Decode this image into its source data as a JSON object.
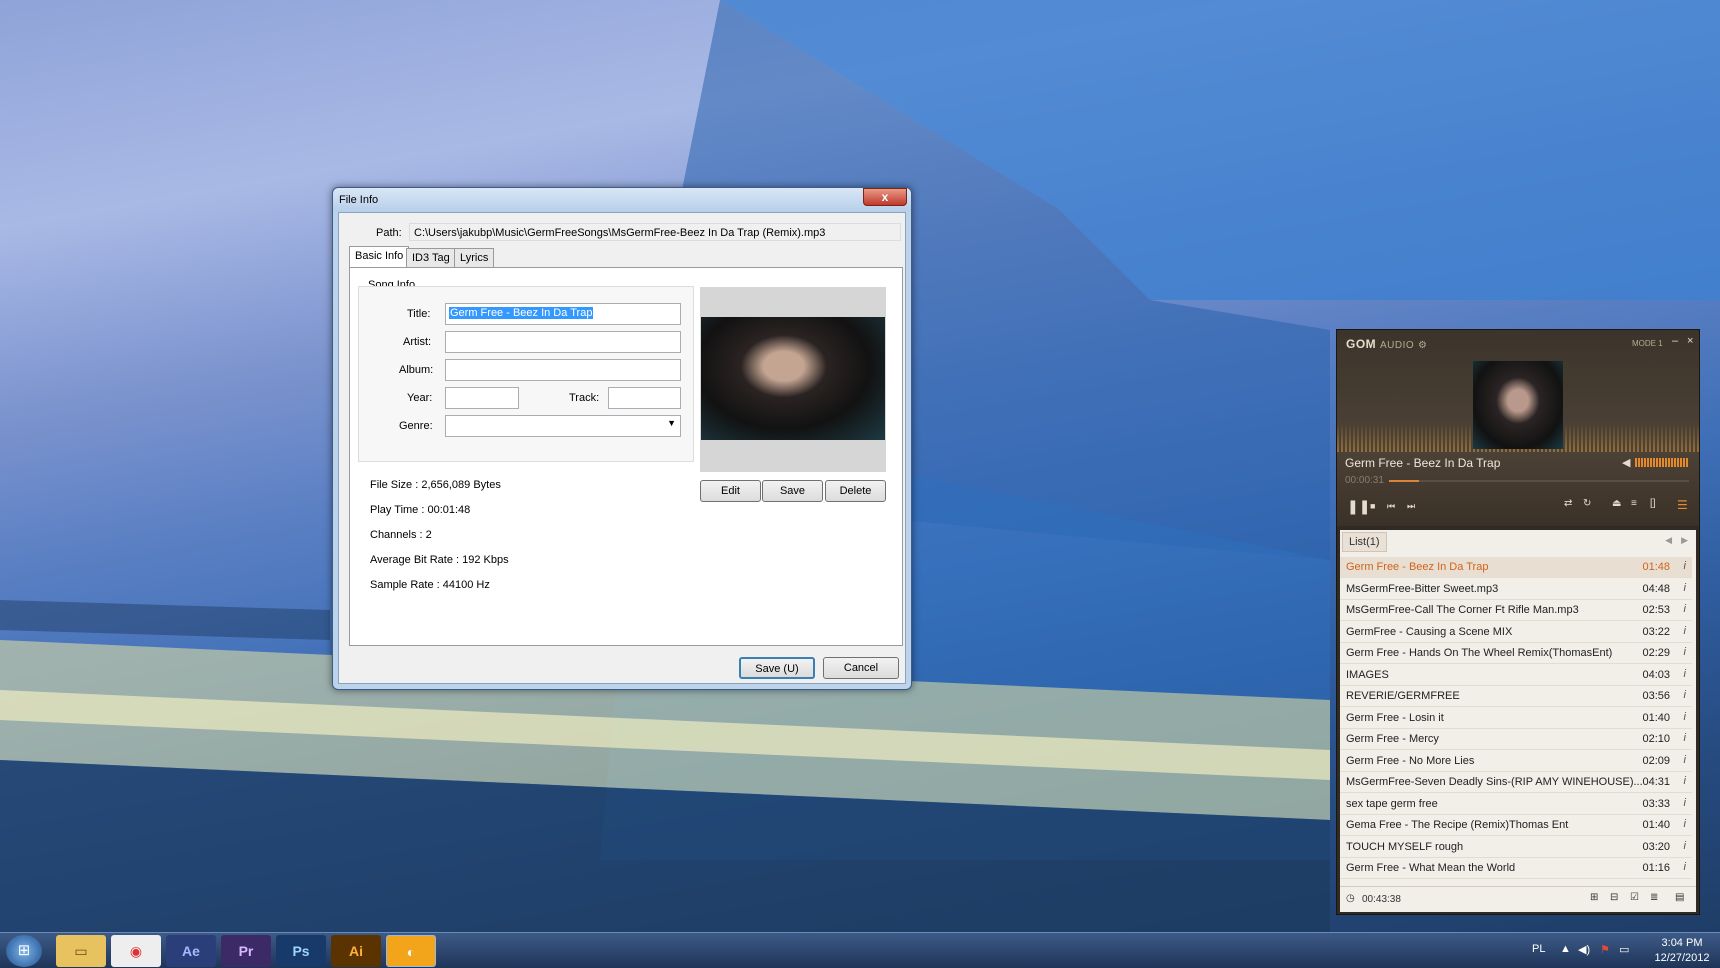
{
  "dialog": {
    "title": "File Info",
    "close": "x",
    "path_label": "Path:",
    "path_value": "C:\\Users\\jakubp\\Music\\GermFreeSongs\\MsGermFree-Beez In Da Trap (Remix).mp3",
    "tabs": [
      "Basic Info",
      "ID3 Tag",
      "Lyrics"
    ],
    "group_title": "Song Info",
    "labels": {
      "title": "Title:",
      "artist": "Artist:",
      "album": "Album:",
      "year": "Year:",
      "track": "Track:",
      "genre": "Genre:"
    },
    "values": {
      "title": "Germ Free - Beez In Da Trap",
      "artist": "",
      "album": "",
      "year": "",
      "track": "",
      "genre": ""
    },
    "art_buttons": {
      "edit": "Edit",
      "save": "Save",
      "delete": "Delete"
    },
    "file_info": [
      "File Size : 2,656,089 Bytes",
      "Play Time : 00:01:48",
      "Channels : 2",
      "Average Bit Rate : 192 Kbps",
      "Sample Rate : 44100 Hz"
    ],
    "save_button": "Save (U)",
    "cancel_button": "Cancel"
  },
  "gom": {
    "logo": "GOM",
    "logo_sub": "AUDIO",
    "mode": "MODE 1",
    "now_playing": "Germ Free - Beez In Da Trap",
    "elapsed": "00:00:31",
    "seek_fraction": 0.1,
    "volume_fraction": 0.95,
    "list_tab": "List(1)",
    "tracks": [
      {
        "name": "Germ Free - Beez In Da Trap",
        "duration": "01:48"
      },
      {
        "name": "MsGermFree-Bitter Sweet.mp3",
        "duration": "04:48"
      },
      {
        "name": "MsGermFree-Call The Corner Ft Rifle Man.mp3",
        "duration": "02:53"
      },
      {
        "name": "GermFree - Causing a Scene MIX",
        "duration": "03:22"
      },
      {
        "name": "Germ Free - Hands On The Wheel Remix(ThomasEnt)",
        "duration": "02:29"
      },
      {
        "name": "IMAGES",
        "duration": "04:03"
      },
      {
        "name": "REVERIE/GERMFREE",
        "duration": "03:56"
      },
      {
        "name": "Germ Free - Losin it",
        "duration": "01:40"
      },
      {
        "name": "Germ Free - Mercy",
        "duration": "02:10"
      },
      {
        "name": "Germ Free - No More Lies",
        "duration": "02:09"
      },
      {
        "name": "MsGermFree-Seven Deadly Sins-(RIP AMY WINEHOUSE)...",
        "duration": "04:31"
      },
      {
        "name": "sex tape germ free",
        "duration": "03:33"
      },
      {
        "name": "Gema Free - The Recipe (Remix)Thomas Ent",
        "duration": "01:40"
      },
      {
        "name": "TOUCH MYSELF rough",
        "duration": "03:20"
      },
      {
        "name": "Germ Free - What Mean the World",
        "duration": "01:16"
      }
    ],
    "total_time": "00:43:38",
    "info_glyph": "i"
  },
  "taskbar": {
    "apps": [
      {
        "name": "explorer",
        "label": "▭"
      },
      {
        "name": "chrome",
        "label": "◉"
      },
      {
        "name": "after-effects",
        "label": "Ae"
      },
      {
        "name": "premiere",
        "label": "Pr"
      },
      {
        "name": "photoshop",
        "label": "Ps"
      },
      {
        "name": "illustrator",
        "label": "Ai"
      },
      {
        "name": "gom-audio",
        "label": "◐"
      }
    ],
    "lang": "PL",
    "time": "3:04 PM",
    "date": "12/27/2012"
  }
}
